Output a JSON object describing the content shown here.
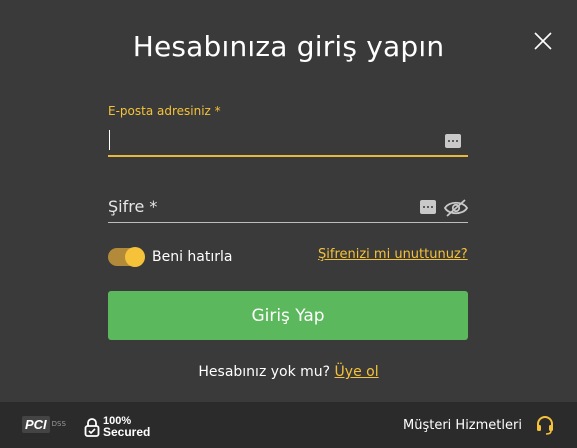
{
  "modal": {
    "title": "Hesabınıza giriş yapın",
    "close_icon": "close-icon"
  },
  "email": {
    "label": "E-posta adresiniz *",
    "value": "",
    "icon": "password-manager-icon"
  },
  "password": {
    "placeholder": "Şifre *",
    "value": "",
    "icons": [
      "password-manager-icon",
      "eye-off-icon"
    ]
  },
  "remember": {
    "label": "Beni hatırla",
    "checked": true
  },
  "forgot_link": "Şifrenizi mi unuttunuz?",
  "login_button": "Giriş Yap",
  "signup": {
    "prompt": "Hesabınız yok mu?",
    "link": "Üye ol"
  },
  "footer": {
    "pci_label": "PCI",
    "pci_sub": "DSS",
    "secured_line1": "100%",
    "secured_line2": "Secured",
    "support_label": "Müşteri Hizmetleri",
    "support_icon": "headset-icon"
  },
  "colors": {
    "background": "#3a3a3a",
    "accent": "#f5c23a",
    "button": "#5cb85c",
    "footer": "#2b2b2b"
  }
}
